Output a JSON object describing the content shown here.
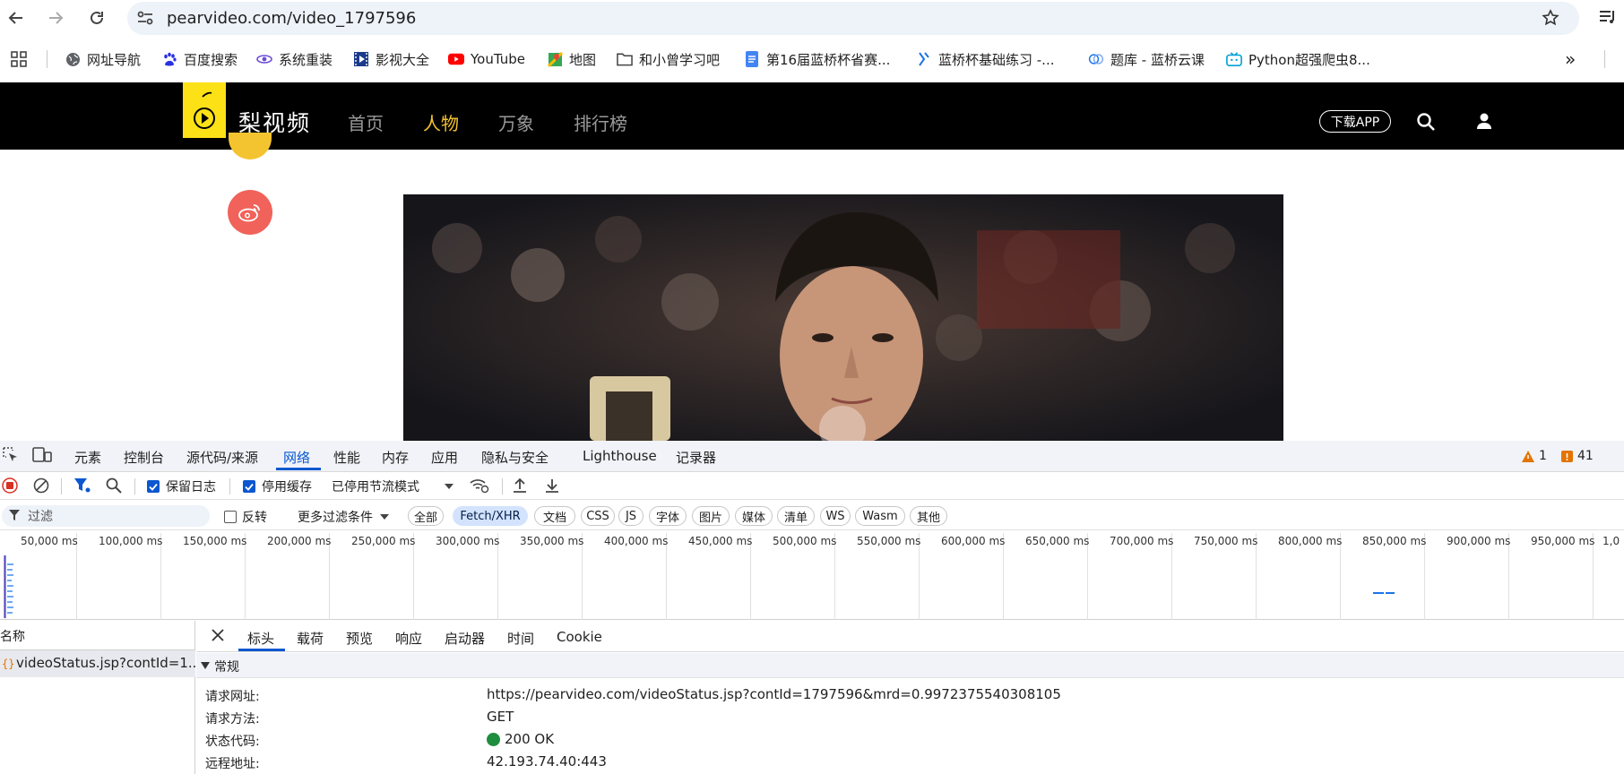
{
  "browser": {
    "url": "pearvideo.com/video_1797596",
    "bookmarks": [
      {
        "label": "网址导航",
        "icon": "globe-icon"
      },
      {
        "label": "百度搜索",
        "icon": "baidu-icon"
      },
      {
        "label": "系统重装",
        "icon": "system-icon"
      },
      {
        "label": "影视大全",
        "icon": "film-icon"
      },
      {
        "label": "YouTube",
        "icon": "youtube-icon"
      },
      {
        "label": "地图",
        "icon": "map-icon"
      },
      {
        "label": "和小曾学习吧",
        "icon": "folder-icon"
      },
      {
        "label": "第16届蓝桥杯省赛...",
        "icon": "doc-icon"
      },
      {
        "label": "蓝桥杯基础练习 -...",
        "icon": "lanqiao-icon"
      },
      {
        "label": "题库 - 蓝桥云课",
        "icon": "cloud-icon"
      },
      {
        "label": "Python超强爬虫8...",
        "icon": "bilibili-icon"
      }
    ],
    "more": "»"
  },
  "site": {
    "name": "梨视频",
    "nav": [
      {
        "label": "首页",
        "active": false
      },
      {
        "label": "人物",
        "active": true
      },
      {
        "label": "万象",
        "active": false
      },
      {
        "label": "排行榜",
        "active": false
      }
    ],
    "download": "下载APP",
    "colors": {
      "brand_yellow": "#fce117",
      "active_nav": "#f4c430",
      "weibo": "#f0625a"
    }
  },
  "devtools": {
    "tabs": [
      "元素",
      "控制台",
      "源代码/来源",
      "网络",
      "性能",
      "内存",
      "应用",
      "隐私与安全",
      "Lighthouse",
      "记录器"
    ],
    "active_tab": "网络",
    "warnings": "1",
    "issues": "41",
    "toolbar": {
      "preserve_log": "保留日志",
      "disable_cache": "停用缓存",
      "throttle": "已停用节流模式"
    },
    "filter": {
      "placeholder": "过滤",
      "invert": "反转",
      "more_filters": "更多过滤条件",
      "chips": [
        "全部",
        "Fetch/XHR",
        "文档",
        "CSS",
        "JS",
        "字体",
        "图片",
        "媒体",
        "清单",
        "WS",
        "Wasm",
        "其他"
      ],
      "selected_chip": "Fetch/XHR"
    },
    "timeline_ticks": [
      "50,000 ms",
      "100,000 ms",
      "150,000 ms",
      "200,000 ms",
      "250,000 ms",
      "300,000 ms",
      "350,000 ms",
      "400,000 ms",
      "450,000 ms",
      "500,000 ms",
      "550,000 ms",
      "600,000 ms",
      "650,000 ms",
      "700,000 ms",
      "750,000 ms",
      "800,000 ms",
      "850,000 ms",
      "900,000 ms",
      "950,000 ms",
      "1,0"
    ],
    "name_header": "名称",
    "request_name": "videoStatus.jsp?contId=1...",
    "detail_tabs": [
      "标头",
      "载荷",
      "预览",
      "响应",
      "启动器",
      "时间",
      "Cookie"
    ],
    "active_detail_tab": "标头",
    "general_label": "常规",
    "general": [
      {
        "key": "请求网址:",
        "value": "https://pearvideo.com/videoStatus.jsp?contId=1797596&mrd=0.9972375540308105"
      },
      {
        "key": "请求方法:",
        "value": "GET"
      },
      {
        "key": "状态代码:",
        "value": "200 OK"
      },
      {
        "key": "远程地址:",
        "value": "42.193.74.40:443"
      }
    ]
  }
}
